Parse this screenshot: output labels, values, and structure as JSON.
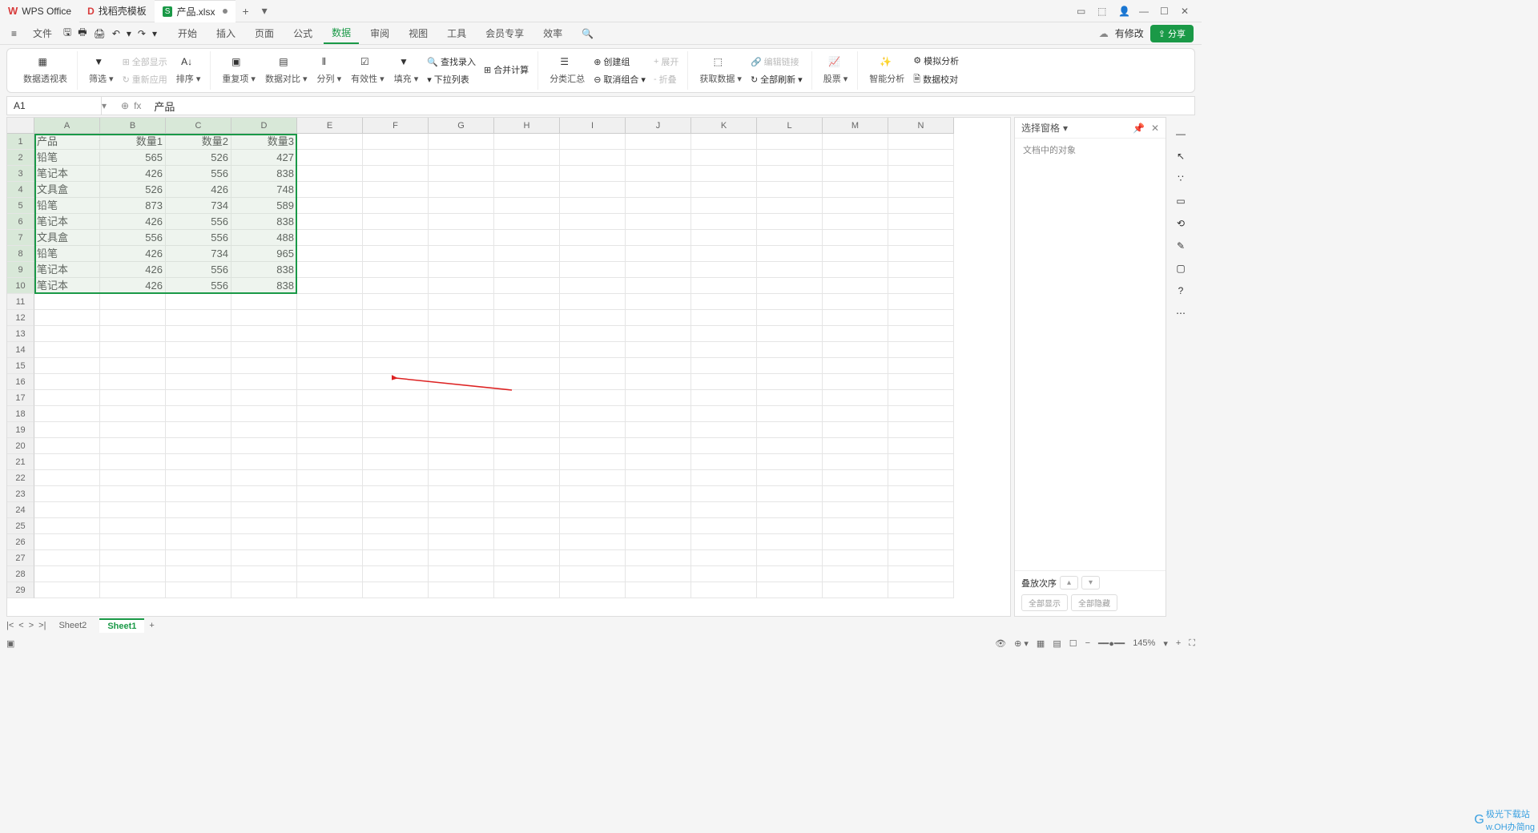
{
  "titlebar": {
    "wps_label": "WPS Office",
    "template_label": "找稻壳模板",
    "doc_label": "产品.xlsx"
  },
  "menubar": {
    "file": "文件",
    "items": [
      "开始",
      "插入",
      "页面",
      "公式",
      "数据",
      "审阅",
      "视图",
      "工具",
      "会员专享",
      "效率"
    ],
    "active_idx": 4,
    "modified": "有修改",
    "share": "分享"
  },
  "ribbon": {
    "pivot": "数据透视表",
    "filter": "筛选",
    "show_all": "全部显示",
    "reapply": "重新应用",
    "sort": "排序",
    "dedup": "重复项",
    "datacmp": "数据对比",
    "split": "分列",
    "validity": "有效性",
    "fill": "填充",
    "find_input": "查找录入",
    "consolidate": "合并计算",
    "dropdown": "下拉列表",
    "subtotal": "分类汇总",
    "group": "创建组",
    "ungroup": "取消组合",
    "expand": "展开",
    "collapse": "折叠",
    "getdata": "获取数据",
    "editlink": "编辑链接",
    "refresh": "全部刷新",
    "stock": "股票",
    "smart": "智能分析",
    "simulate": "模拟分析",
    "audit": "数据校对"
  },
  "formula": {
    "cell_ref": "A1",
    "content": "产品"
  },
  "sheet": {
    "cols": [
      "A",
      "B",
      "C",
      "D",
      "E",
      "F",
      "G",
      "H",
      "I",
      "J",
      "K",
      "L",
      "M",
      "N"
    ],
    "headers": [
      "产品",
      "数量1",
      "数量2",
      "数量3"
    ],
    "rows": [
      [
        "铅笔",
        "565",
        "526",
        "427"
      ],
      [
        "笔记本",
        "426",
        "556",
        "838"
      ],
      [
        "文具盒",
        "526",
        "426",
        "748"
      ],
      [
        "铅笔",
        "873",
        "734",
        "589"
      ],
      [
        "笔记本",
        "426",
        "556",
        "838"
      ],
      [
        "文具盒",
        "556",
        "556",
        "488"
      ],
      [
        "铅笔",
        "426",
        "734",
        "965"
      ],
      [
        "笔记本",
        "426",
        "556",
        "838"
      ],
      [
        "笔记本",
        "426",
        "556",
        "838"
      ]
    ]
  },
  "right_panel": {
    "title": "选择窗格",
    "subtitle": "文档中的对象",
    "stack": "叠放次序",
    "show_all": "全部显示",
    "hide_all": "全部隐藏"
  },
  "tabs": {
    "sheet2": "Sheet2",
    "sheet1": "Sheet1"
  },
  "status": {
    "zoom": "145%"
  },
  "watermark": {
    "line1": "极光下载站",
    "line2": "w.OH办简ng"
  }
}
